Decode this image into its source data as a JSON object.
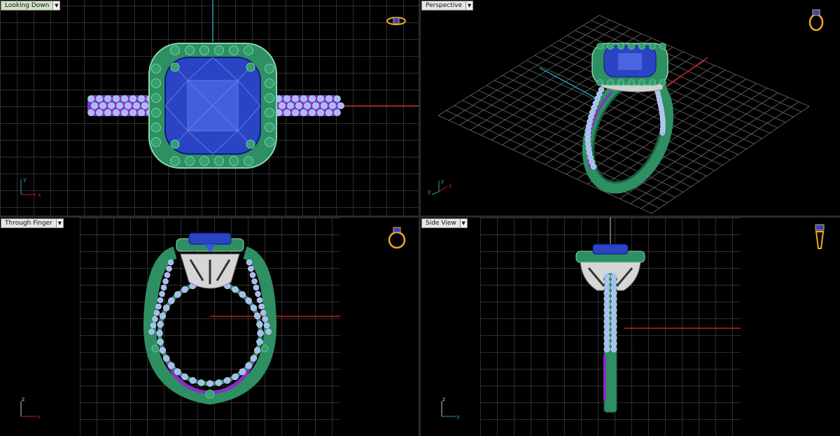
{
  "app": "3D jewelry CAD — four viewport layout",
  "colors": {
    "background": "#000000",
    "grid_minor": "#5a5a5a",
    "grid_major": "#8c8c8c",
    "axis_x": "#c81e1e",
    "axis_y": "#1ea0b4",
    "metal_green": "#2e8f62",
    "metal_white": "#c8c8c8",
    "gem_blue": "#3246c8",
    "pave_blue": "#9ab4f0",
    "accent_purple": "#8a2ec8",
    "nav_gold": "#f0a828",
    "viewport_border": "#c8c8c8"
  },
  "viewports": {
    "top_left": {
      "label": "Looking Down",
      "menu_icon": "triangle-down-icon",
      "active": true,
      "axes": [
        "y",
        "x"
      ]
    },
    "top_right": {
      "label": "Perspective",
      "menu_icon": "triangle-down-icon",
      "active": false,
      "axes": [
        "z",
        "y",
        "x"
      ]
    },
    "bottom_left": {
      "label": "Through Finger",
      "menu_icon": "triangle-down-icon",
      "active": false,
      "axes": [
        "z",
        "x"
      ]
    },
    "bottom_right": {
      "label": "Side View",
      "menu_icon": "triangle-down-icon",
      "active": false,
      "axes": [
        "z",
        "y"
      ]
    }
  }
}
